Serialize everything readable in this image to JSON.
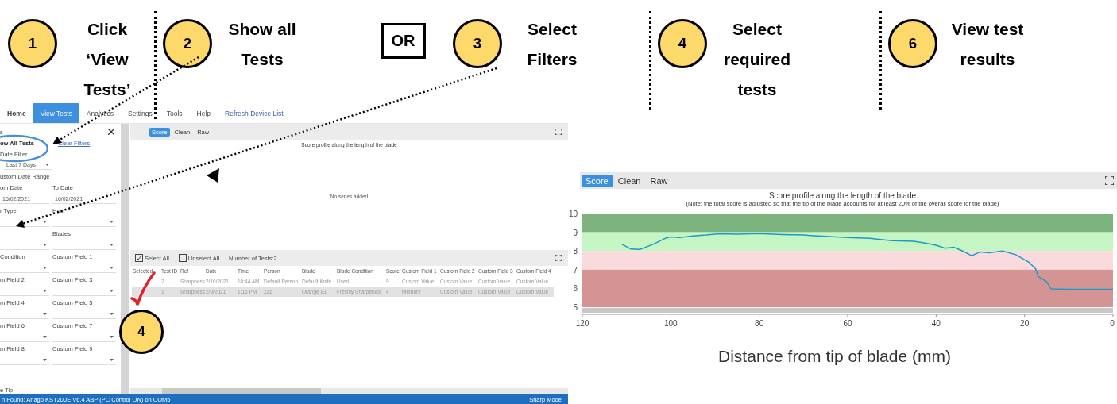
{
  "steps": [
    {
      "kind": "step",
      "number": "1",
      "lines": [
        "Click",
        "‘View",
        "Tests’"
      ]
    },
    {
      "kind": "step",
      "number": "2",
      "lines": [
        "Show all",
        "Tests"
      ]
    },
    {
      "kind": "or",
      "label": "OR"
    },
    {
      "kind": "step",
      "number": "3",
      "lines": [
        "Select",
        "Filters"
      ]
    },
    {
      "kind": "step",
      "number": "4",
      "lines": [
        "Select",
        "required",
        "tests"
      ]
    },
    {
      "kind": "step",
      "number": "6",
      "lines": [
        "View test",
        "results"
      ]
    }
  ],
  "app": {
    "menu": [
      {
        "label": "Home",
        "selected": false,
        "kind": "bold"
      },
      {
        "label": "View Tests",
        "selected": true,
        "kind": "tab"
      },
      {
        "label": "Analytics",
        "selected": false,
        "kind": "tab"
      },
      {
        "label": "Settings",
        "selected": false,
        "kind": "tab"
      },
      {
        "label": "Tools",
        "selected": false,
        "kind": "tab"
      },
      {
        "label": "Help",
        "selected": false,
        "kind": "tab"
      },
      {
        "label": "Refresh Device List",
        "selected": false,
        "kind": "link"
      }
    ],
    "filters": {
      "header": "s",
      "show_all": "ow All Tests",
      "clear": "Clear Filters",
      "date_filter": "Date Filter",
      "date_value": "Last 7 Days",
      "custom_range": "ustom Date Range",
      "from_label": "om Date",
      "to_label": "To Date",
      "from_value": "16/02/2021",
      "to_value": "16/02/2021",
      "rows": [
        {
          "left": "r Type",
          "right": "Hour"
        },
        {
          "right": "Blades"
        },
        {
          "left": "Condition",
          "right": "Custom Field 1"
        },
        {
          "left": "m Field 2",
          "right": "Custom Field 3"
        },
        {
          "left": "m Field 4",
          "right": "Custom Field 5"
        },
        {
          "left": "m Field 6",
          "right": "Custom Field 7"
        },
        {
          "left": "m Field 8",
          "right": "Custom Field 9"
        }
      ],
      "footer": "e Tip"
    },
    "chart_tabs": [
      {
        "label": "Score",
        "selected": true
      },
      {
        "label": "Clean",
        "selected": false
      },
      {
        "label": "Raw",
        "selected": false
      }
    ],
    "chart_title": "Score profile along the length of the blade",
    "empty_message": "No series added",
    "table": {
      "select_all": "Select All",
      "unselect_all": "Unselect All",
      "count": "Number of Tests:2",
      "columns": [
        "Selected",
        "Test ID",
        "Ref",
        "Date",
        "Time",
        "Person",
        "Blade",
        "Blade Condition",
        "Score",
        "Custom Field 1",
        "Custom Field 2",
        "Custom Field 3",
        "Custom Field 4"
      ],
      "rows": [
        {
          "selected": false,
          "cells": [
            "",
            "2",
            "Sharpness",
            "2/16/2021",
            "10:44 AM",
            "Default Person",
            "Default Knife",
            "Used",
            "9",
            "Custom Value",
            "Custom Value",
            "Custom Value",
            "Custom Value"
          ]
        },
        {
          "selected": true,
          "cells": [
            "",
            "1",
            "Sharpness",
            "2/9/2021",
            "1:16 PM",
            "Zac",
            "Orange 83",
            "Freshly Sharpened",
            "4",
            "Memory",
            "Custom Value",
            "Custom Value",
            "Custom Value"
          ]
        }
      ]
    },
    "status": {
      "left": "n Found: Anago KST200E V6.4 ABP (PC Control ON) on COM5",
      "right": "Sharp Mode"
    },
    "callout": {
      "number": "4"
    }
  },
  "result": {
    "tabs": [
      {
        "label": "Score",
        "selected": true
      },
      {
        "label": "Clean",
        "selected": false
      },
      {
        "label": "Raw",
        "selected": false
      }
    ],
    "title": "Score profile along the length of the blade",
    "note": "(Note: the total score is adjusted so that the tip of the blade accounts for at least 20% of the overall score for the blade)",
    "chart_data": {
      "type": "line",
      "xlabel": "Distance from tip of blade (mm)",
      "xlim": [
        120,
        0
      ],
      "ylim": [
        5,
        10
      ],
      "xticks": [
        120,
        100,
        80,
        60,
        40,
        20,
        0
      ],
      "bands": [
        {
          "axis": "y",
          "from": 9,
          "to": 10,
          "color": "#7db37d"
        },
        {
          "axis": "y",
          "from": 8,
          "to": 9,
          "color": "#c6f5c4"
        },
        {
          "axis": "y",
          "from": 7,
          "to": 8,
          "color": "#fadadd"
        },
        {
          "axis": "y",
          "from": 5,
          "to": 7,
          "color": "#d49494"
        }
      ],
      "yticks": [
        5,
        6,
        7,
        8,
        9,
        10
      ],
      "x": [
        111,
        109,
        107,
        104,
        101,
        100,
        98,
        95,
        92,
        89,
        85,
        80,
        75,
        70,
        65,
        60,
        55,
        50,
        45,
        42,
        40,
        38,
        36,
        34,
        32,
        30,
        28,
        25,
        22,
        19,
        17.5,
        17,
        15,
        14,
        10,
        5,
        0
      ],
      "series": [
        {
          "color": "#1a9bc9",
          "values": [
            8.35,
            8.1,
            8.08,
            8.35,
            8.7,
            8.75,
            8.72,
            8.8,
            8.85,
            8.92,
            8.9,
            8.93,
            8.88,
            8.85,
            8.78,
            8.72,
            8.68,
            8.55,
            8.52,
            8.4,
            8.3,
            8.15,
            8.2,
            8.0,
            7.75,
            7.95,
            7.9,
            8.0,
            7.8,
            7.4,
            7.05,
            6.65,
            6.35,
            5.97,
            5.95,
            5.95,
            5.95
          ]
        }
      ]
    }
  }
}
